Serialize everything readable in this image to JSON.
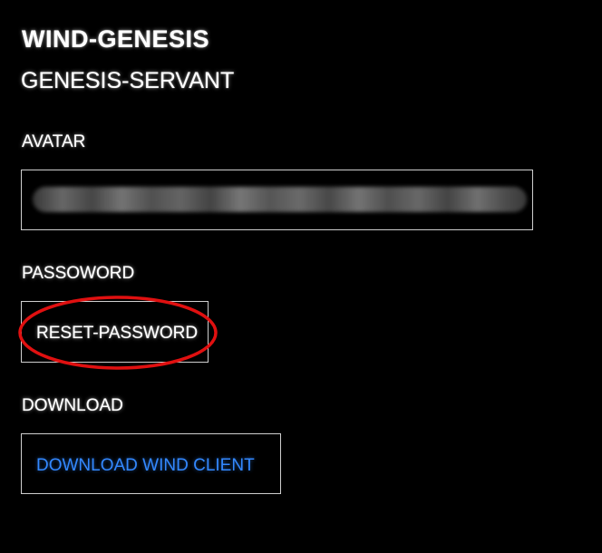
{
  "header": {
    "app_title": "WIND-GENESIS",
    "username": "GENESIS-SERVANT"
  },
  "avatar": {
    "label": "AVATAR"
  },
  "password": {
    "label": "PASSOWORD",
    "reset_button": "RESET-PASSWORD"
  },
  "download": {
    "label": "DOWNLOAD",
    "link": "DOWNLOAD WIND CLIENT"
  },
  "colors": {
    "background": "#000000",
    "text": "#ffffff",
    "link": "#3388ff",
    "highlight_ellipse": "#e01010",
    "box_border": "#cfcfcf"
  }
}
